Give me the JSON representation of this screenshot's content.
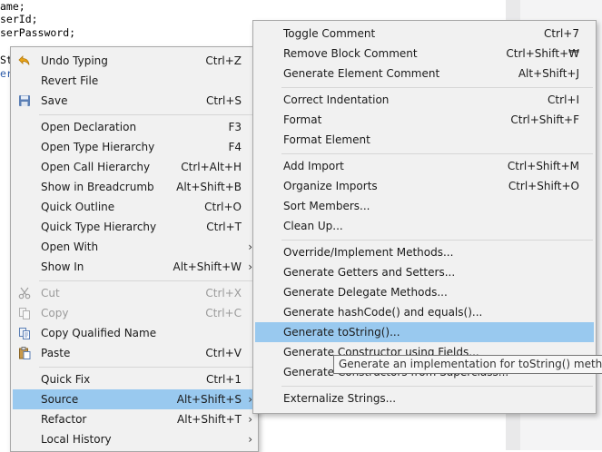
{
  "editor": {
    "code_lines": [
      "ame;",
      "serId;",
      "serPassword;"
    ],
    "left_fragments": [
      "St",
      "er"
    ]
  },
  "context_menu": {
    "items": [
      {
        "label": "Undo Typing",
        "shortcut": "Ctrl+Z",
        "icon": "undo-icon"
      },
      {
        "label": "Revert File",
        "shortcut": ""
      },
      {
        "label": "Save",
        "shortcut": "Ctrl+S",
        "icon": "save-icon"
      },
      {
        "label": "Open Declaration",
        "shortcut": "F3"
      },
      {
        "label": "Open Type Hierarchy",
        "shortcut": "F4"
      },
      {
        "label": "Open Call Hierarchy",
        "shortcut": "Ctrl+Alt+H"
      },
      {
        "label": "Show in Breadcrumb",
        "shortcut": "Alt+Shift+B"
      },
      {
        "label": "Quick Outline",
        "shortcut": "Ctrl+O"
      },
      {
        "label": "Quick Type Hierarchy",
        "shortcut": "Ctrl+T"
      },
      {
        "label": "Open With",
        "shortcut": "",
        "submenu": true
      },
      {
        "label": "Show In",
        "shortcut": "Alt+Shift+W",
        "submenu": true
      },
      {
        "label": "Cut",
        "shortcut": "Ctrl+X",
        "disabled": true,
        "icon": "cut-icon"
      },
      {
        "label": "Copy",
        "shortcut": "Ctrl+C",
        "disabled": true,
        "icon": "copy-icon"
      },
      {
        "label": "Copy Qualified Name",
        "shortcut": "",
        "icon": "copy-qualified-name-icon"
      },
      {
        "label": "Paste",
        "shortcut": "Ctrl+V",
        "icon": "paste-icon"
      },
      {
        "label": "Quick Fix",
        "shortcut": "Ctrl+1"
      },
      {
        "label": "Source",
        "shortcut": "Alt+Shift+S",
        "submenu": true,
        "highlighted": true
      },
      {
        "label": "Refactor",
        "shortcut": "Alt+Shift+T",
        "submenu": true
      },
      {
        "label": "Local History",
        "shortcut": "",
        "submenu": true
      }
    ]
  },
  "source_submenu": {
    "items": [
      {
        "label": "Toggle Comment",
        "shortcut": "Ctrl+7"
      },
      {
        "label": "Remove Block Comment",
        "shortcut": "Ctrl+Shift+₩"
      },
      {
        "label": "Generate Element Comment",
        "shortcut": "Alt+Shift+J"
      },
      {
        "label": "Correct Indentation",
        "shortcut": "Ctrl+I"
      },
      {
        "label": "Format",
        "shortcut": "Ctrl+Shift+F"
      },
      {
        "label": "Format Element",
        "shortcut": ""
      },
      {
        "label": "Add Import",
        "shortcut": "Ctrl+Shift+M"
      },
      {
        "label": "Organize Imports",
        "shortcut": "Ctrl+Shift+O"
      },
      {
        "label": "Sort Members...",
        "shortcut": ""
      },
      {
        "label": "Clean Up...",
        "shortcut": ""
      },
      {
        "label": "Override/Implement Methods...",
        "shortcut": ""
      },
      {
        "label": "Generate Getters and Setters...",
        "shortcut": ""
      },
      {
        "label": "Generate Delegate Methods...",
        "shortcut": ""
      },
      {
        "label": "Generate hashCode() and equals()...",
        "shortcut": ""
      },
      {
        "label": "Generate toString()...",
        "shortcut": "",
        "highlighted": true
      },
      {
        "label": "Generate Constructor using Fields...",
        "shortcut": ""
      },
      {
        "label": "Generate Constructors from Superclass...",
        "shortcut": ""
      },
      {
        "label": "Externalize Strings...",
        "shortcut": ""
      }
    ]
  },
  "tooltip": {
    "text": "Generate an implementation for toString() method"
  },
  "colors": {
    "highlight": "#99c9ef",
    "menu_background": "#f1f1f1",
    "disabled_text": "#9a9a9a"
  }
}
